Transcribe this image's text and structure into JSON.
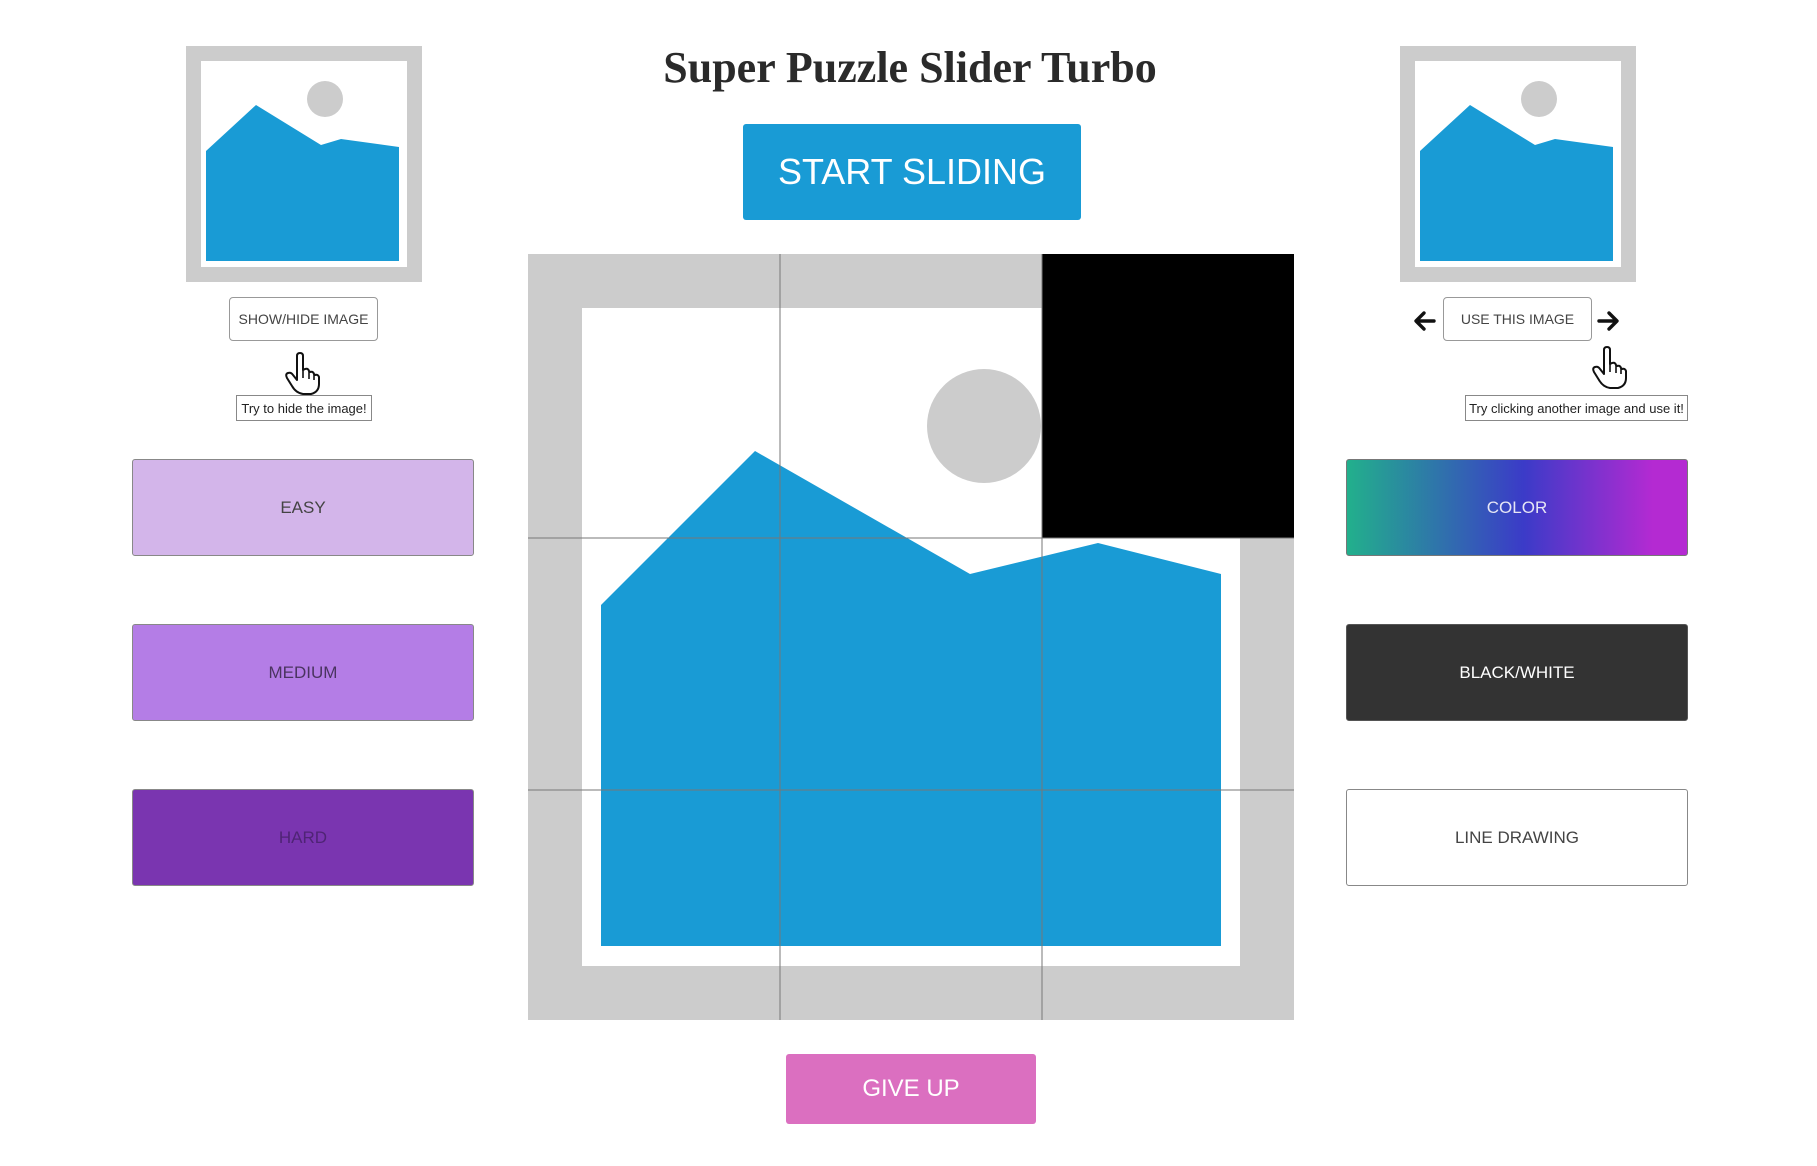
{
  "title": "Super Puzzle Slider Turbo",
  "start_button": "START SLIDING",
  "give_up_button": "GIVE UP",
  "left_panel": {
    "show_hide_button": "SHOW/HIDE IMAGE",
    "tooltip": "Try to hide the image!",
    "difficulty": [
      {
        "label": "EASY",
        "color": "#d3b5ea"
      },
      {
        "label": "MEDIUM",
        "color": "#b47de6"
      },
      {
        "label": "HARD",
        "color": "#7a35b0"
      }
    ]
  },
  "right_panel": {
    "use_image_button": "USE THIS IMAGE",
    "tooltip": "Try clicking another image and use it!",
    "prev_icon": "arrow-left-icon",
    "next_icon": "arrow-right-icon",
    "modes": [
      {
        "label": "COLOR",
        "gradient": [
          "#22b08c",
          "#3b3bc8",
          "#b42ad2"
        ]
      },
      {
        "label": "BLACK/WHITE",
        "color": "#333333"
      },
      {
        "label": "LINE DRAWING",
        "color": "#ffffff"
      }
    ]
  },
  "puzzle": {
    "grid": "3x3",
    "empty_tile": {
      "row": 1,
      "col": 3
    }
  },
  "colors": {
    "accent_blue": "#199bd5",
    "frame_gray": "#cccccc",
    "give_up_pink": "#db6fc0"
  }
}
